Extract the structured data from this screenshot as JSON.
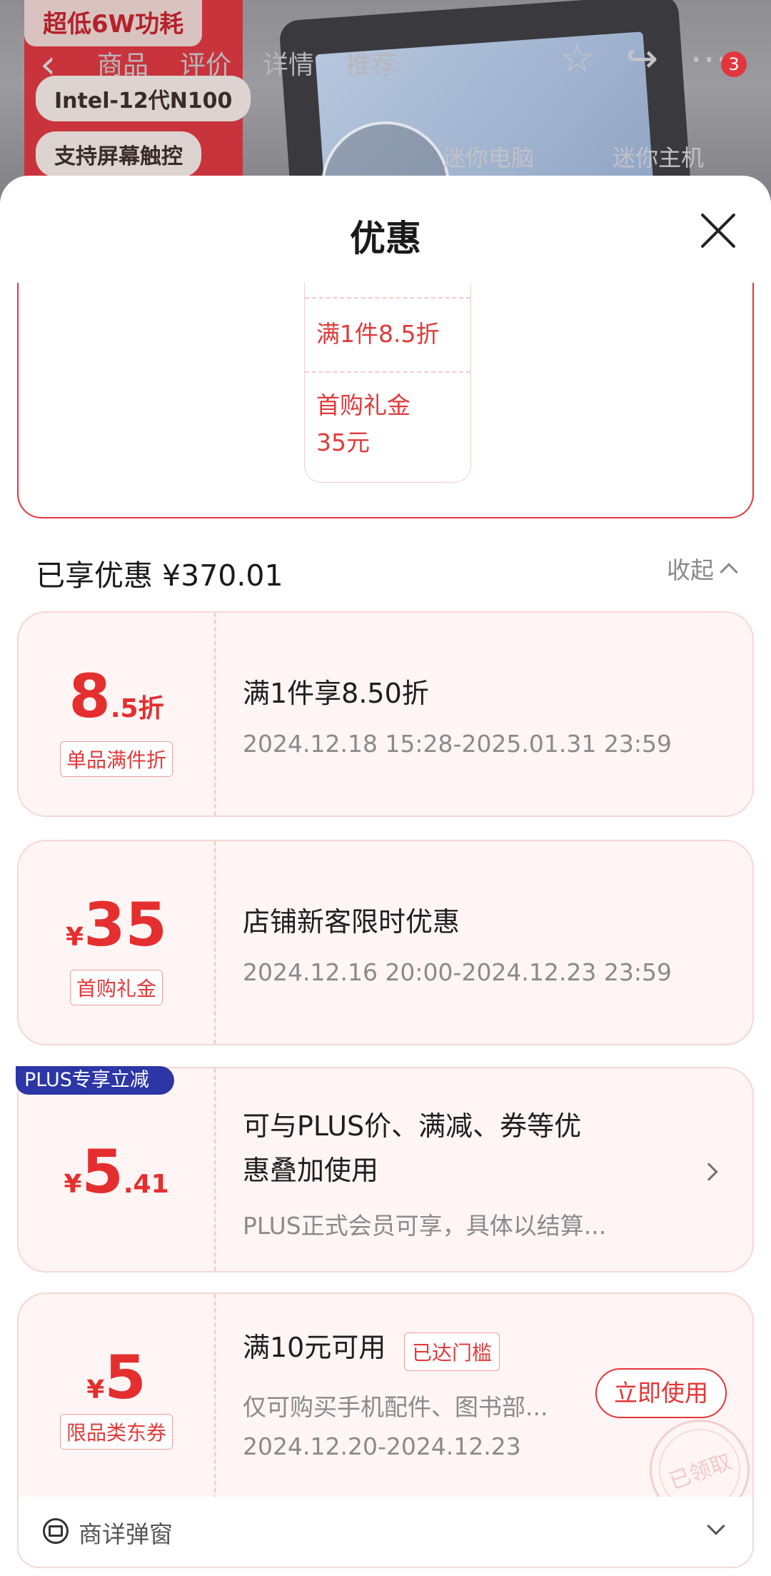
{
  "background": {
    "promo_top": "超低6W功耗",
    "pill_cpu": "Intel-12代N100",
    "pill_touch": "支持屏幕触控",
    "tabs": [
      "商品",
      "评价",
      "详情",
      "推荐"
    ],
    "badge_count": "3",
    "sub_labels": [
      "迷你电脑",
      "迷你主机"
    ]
  },
  "sheet": {
    "title": "优惠",
    "promo_items": [
      "满1件8.5折",
      "首购礼金\n35元"
    ],
    "summary": "已享优惠 ¥370.01",
    "collapse_label": "收起"
  },
  "coupons": [
    {
      "amount_big": "8",
      "amount_small": ".5折",
      "tag": "单品满件折",
      "title": "满1件享8.50折",
      "sub": "2024.12.18 15:28-2025.01.31 23:59"
    },
    {
      "yen": "¥",
      "amount_big": "35",
      "tag": "首购礼金",
      "title": "店铺新客限时优惠",
      "sub": "2024.12.16 20:00-2024.12.23 23:59"
    },
    {
      "badge": "PLUS专享立减",
      "yen": "¥",
      "amount_big": "5",
      "amount_small": ".41",
      "title_line1": "可与PLUS价、满减、券等优",
      "title_line2": "惠叠加使用",
      "sub": "PLUS正式会员可享，具体以结算..."
    },
    {
      "yen": "¥",
      "amount_big": "5",
      "tag": "限品类东券",
      "title": "满10元可用",
      "reached": "已达门槛",
      "sub1": "仅可购买手机配件、图书部...",
      "sub2": "2024.12.20-2024.12.23",
      "button": "立即使用",
      "stamp": "已领取"
    }
  ],
  "bottom_bar": {
    "label": "商详弹窗"
  },
  "colors": {
    "accent": "#e52e2e",
    "plus_badge": "#2c36a6",
    "coupon_bg": "#fff5f4"
  }
}
